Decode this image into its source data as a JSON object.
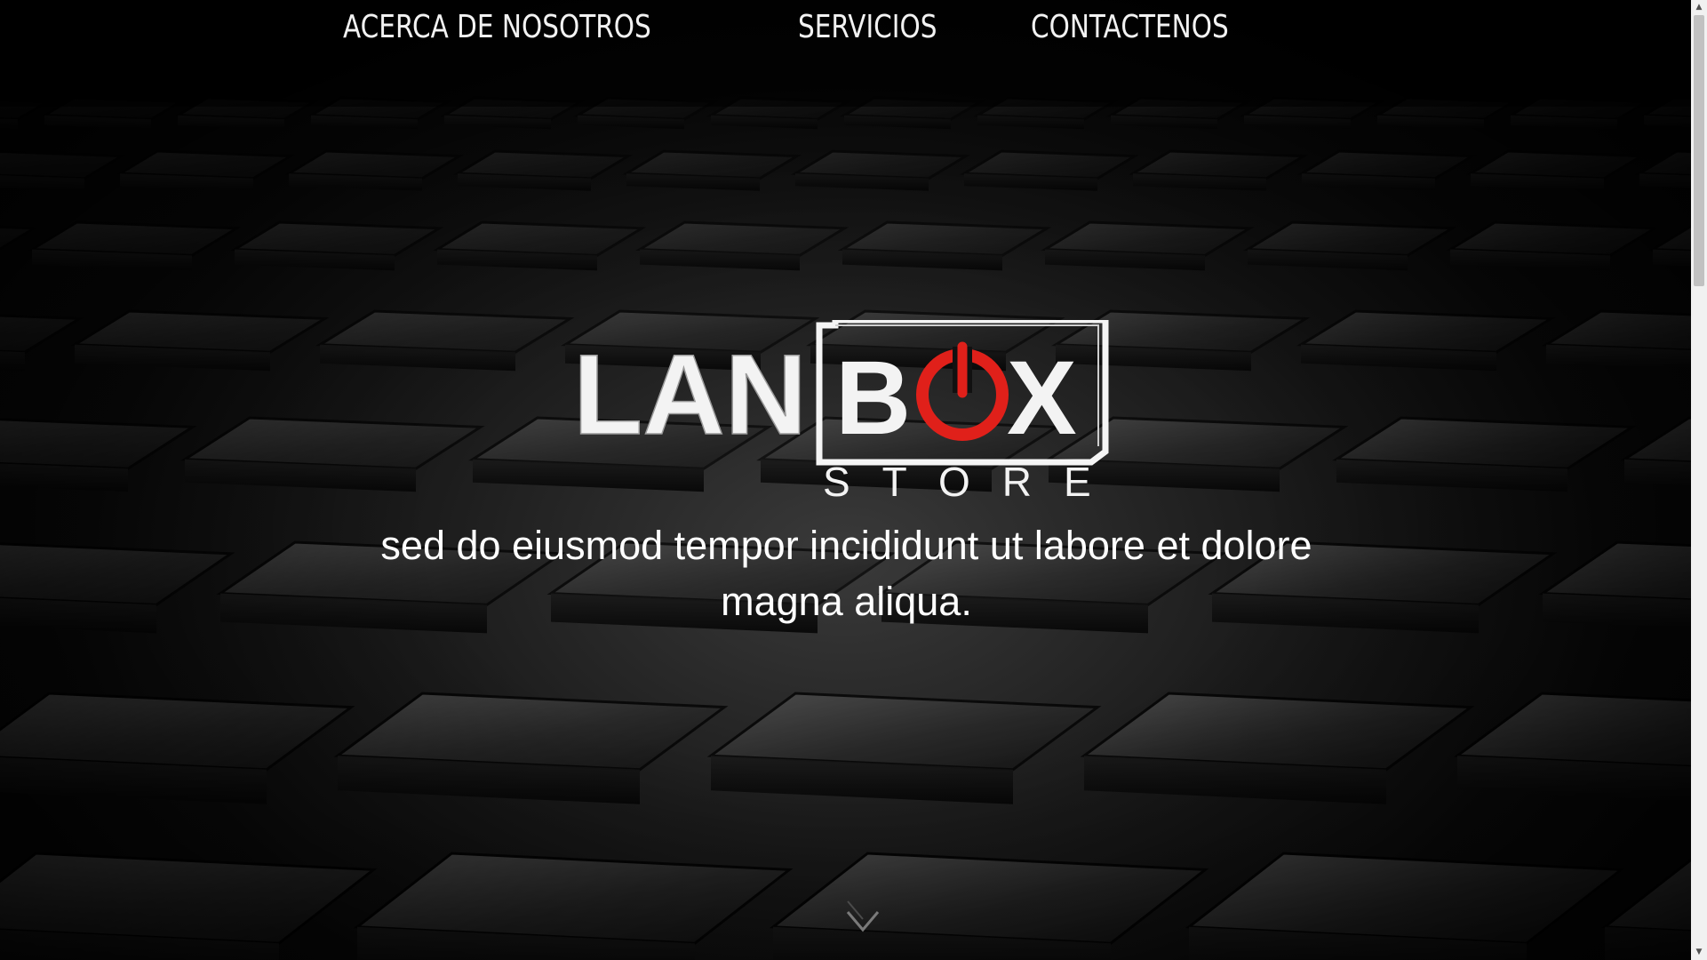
{
  "nav": {
    "items": [
      {
        "label": "ACERCA DE NOSOTROS"
      },
      {
        "label": "SERVICIOS"
      },
      {
        "label": "CONTACTENOS"
      }
    ]
  },
  "logo": {
    "word_left": "LAN",
    "word_boxed": "BOX",
    "subtitle": "STORE",
    "accent_color": "#e0201a"
  },
  "hero": {
    "tagline": "sed do eiusmod tempor incididunt ut labore et dolore magna aliqua."
  },
  "icons": {
    "scroll_down": "chevron-down-icon",
    "power": "power-icon"
  },
  "colors": {
    "background": "#000000",
    "text": "#ffffff",
    "accent": "#e0201a"
  }
}
